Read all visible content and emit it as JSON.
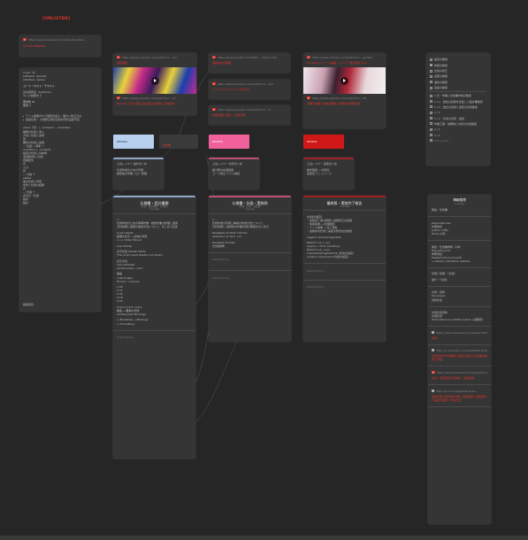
{
  "board": {
    "title": "[UNLISTED]",
    "accent": "#e4362c",
    "background": "#262626"
  },
  "left_link": {
    "url": "https://www.docswell.com/s/6/a-derivative",
    "title": "ACTIVE PENDING"
  },
  "notes": {
    "header_lines": [
      "Code：Ⓜ",
      "software: derived",
      "interface: derive"
    ],
    "subtitle": "コード・カスト・テキスト",
    "meta_lines": [
      "近似値算出（systems)",
      "ちくわ鍵屋まで"
    ],
    "count_lines": [
      "要素数 81",
      "要素 0"
    ],
    "bullets": [
      "テスト結果がUIで閲覧出来る・細かい修正済み",
      "追加仕様・ 大幅修正後の自然計算式実装予定"
    ],
    "tree": [
      "value（式） ← (ordered — evaluate)",
      "  種類の仕様と導入",
      "  方法と仕様と実例",
      "  例",
      "  要件の仕様と実例",
      "— 仕組 ← 解析 ↑",
      "modifiers ← contexts",
      "  設定の仕様と具体例",
      "  (処理状態と仕様)",
      "  自動配列",
      "  式",
      "  入力",
      "  式",
      "— 分岐 ↑",
      "states",
      "  値の仕様と作用",
      "  条件と仕様の結果",
      "  式",
      "— 仕組 ↑",
      "表示の・仕様",
      "  操作",
      "  設計"
    ],
    "footer": "関連項目"
  },
  "videos": [
    {
      "url": "https://www.youtube.com/watch?v=...abc",
      "title": "回転図面"
    },
    {
      "url": "https://youtu.be/Mcch7m8L90 — tutorial link",
      "title": "回転物の切断面"
    },
    {
      "url": "https://www.youtube.com/watch?v=...gsn9zh",
      "title": "YouTubeストリーム講座 - メンバー限定配信 Vol.1"
    }
  ],
  "video_links_b": [
    {
      "url": "https://www.youtube.com/watch?v=...b7",
      "title": "Blender入門4 回転と拡大縮小の操作と基本操作"
    },
    {
      "url": "https://www.youtube.com/watch?v=...k12",
      "title": "ビジュアルスクリプトで作るUI"
    },
    {
      "url": "https://www.youtube.com/watch?v=...m3",
      "title": "中間処理と応用 — 実装演習"
    }
  ],
  "video_links_c": [
    {
      "url": "https://www.youtube.com/watch?v=...r2",
      "title": "記事"
    },
    {
      "url": "https://www.youtube.com/watch?v=...h8",
      "title": "手書き作業と内容の要約と効果的な整理方法"
    }
  ],
  "chips": [
    {
      "label": "DESIGN",
      "bg": "#b8d0f0",
      "fg": "#2a2a2a"
    },
    {
      "label": "",
      "bg": "#3a3a3a",
      "fg": "#e4362c",
      "sub": "仕様書"
    },
    {
      "label": "REVIEW",
      "bg": "#f0609a",
      "fg": "#ffffff"
    },
    {
      "label": "STATUS",
      "bg": "#d01818",
      "fg": "#ffffff"
    }
  ],
  "mini_cards": [
    {
      "lines": [
        "上位レイヤー 設計まとめ",
        "",
        "仕様作成のための手順",
        "確認後の作業 フロー整理"
      ],
      "bar": "#8fa8c8"
    },
    {
      "lines": [
        "上位レイヤー 共有まとめ",
        "",
        "各分野の共通認識",
        "コード修正 テスト検証"
      ],
      "bar": "#c05070"
    },
    {
      "lines": [
        "上位レイヤー 実装まとめ",
        "",
        "動作確認 → 仕様化",
        "実装完了と リリース"
      ],
      "bar": "#a02020"
    }
  ],
  "columns": [
    {
      "title": "仕様書・設計書類",
      "subtitle": "（仕様・設計書類・計画案）",
      "meta": "In scope",
      "bar": "#8fa8c8",
      "body": [
        "□",
        "仕様作成のための準備作業・確認作業の整理と運用",
        "方針説明と結果の確認方法について、まとめて記述",
        "",
        "Code Viewer",
        "  結果を表示 → 反映の状態",
        "  <<< Order Moved",
        "",
        "Live Shader",
        "",
        "表示仕様 Shader Editor",
        "This unit's input shader not shown",
        "",
        "表示方法",
        "sourceShader",
        "surface.pack → surf",
        "",
        "描画",
        "output.rgba",
        "fil.color → out.pix",
        "",
        "1.00",
        "0.72",
        "0.35",
        "0.18",
        "0.25",
        "",
        "0.5.0 / 0.2.0 / 0.0.1",
        "構造 → 要素の状態",
        "surface.pack Bindings",
        "",
        "← Bindables → Bindings",
        "← Formatting"
      ],
      "placeholder": "Start typing..."
    },
    {
      "title": "仕様書・計画・実装例",
      "subtitle": "（仕様・計画・実装例）",
      "meta": "In scope",
      "bar": "#c05070",
      "body": [
        "□",
        "仕様作成の手順と構成の作成方法について、",
        "方針説明と 段階的な作業手順の確認をまとめる",
        "",
        "Reusable Location Domain",
        "  extension  (1 hour +1)",
        "",
        "Reusable Domain",
        "  (仕様説明)"
      ],
      "placeholder": "Start typing..."
    },
    {
      "title": "最終版・実装完了報告",
      "subtitle": "In scope",
      "meta": "",
      "bar": "#a02020",
      "body": [
        "[仕様の確定]",
        "・実装完了後の確認と最終修正の実施",
        "・本番適用 → 反映確認",
        "・テスト結果 → 完了報告",
        "・最終的な仕様と実装の整合性を確認",
        "",
        "Legend: Dump/magicable",
        "",
        "Result in.js  ↓ e.js",
        "  require → from (result.js)",
        "Result in.js → e.js",
        "  interactiveFragmentLib  (仕様の設定)",
        "  surface.component  (仕様の設定)"
      ],
      "placeholder": "Start typing..."
    }
  ],
  "checklist": {
    "items": [
      {
        "label": "設定の確認",
        "on": false
      },
      {
        "label": "参照の確認",
        "on": true
      },
      {
        "label": "仕様の修正",
        "on": false
      },
      {
        "label": "実装の確認",
        "on": false
      },
      {
        "label": "進捗の確認",
        "on": false
      },
      {
        "label": "追加の確認",
        "on": false
      }
    ],
    "tasks": [
      {
        "label": "1 日・作業と仕様書作成の確認",
        "on": false
      },
      {
        "label": "1 / 1：過去の記録を収集して設計書確認",
        "on": false
      },
      {
        "label": "1 / 1：過去の記録と実装の仕様確認",
        "on": false
      },
      {
        "label": "1 / 1",
        "on": false
      },
      {
        "label": "1 / 1：仕様の比較・追加",
        "on": false
      },
      {
        "label": "作業工程・成果物と共有の仕様確認",
        "on": false
      },
      {
        "label": "1 / 1",
        "on": false
      },
      {
        "label": "1 / 1",
        "on": false
      },
      {
        "label": "Add a task...",
        "on": false
      }
    ]
  },
  "right_panel": {
    "title": "情報整理",
    "subtitle": "In scope",
    "sections": [
      [
        "関連・仕様書"
      ],
      [
        "Dependencies",
        "  外部依存",
        "    python  (1件)",
        "    three  (1件)"
      ],
      [
        "関連・仕様書参照（1件）",
        "Repository.md",
        "  参照項目",
        "    Related (Find yourself)",
        "    → reload ( relocation relative"
      ],
      [
        "状態と整理・（仕様）",
        "",
        "進行・（仕様）"
      ],
      [
        "仕様・資料",
        "Developer",
        "資料仕様"
      ],
      [
        "仕様仕様資料",
        "共通仕様",
        "Hello Owner 0.1.0000 custom 公開時刻"
      ]
    ],
    "links": [
      {
        "url": "https://www.docswell.com/s/a/abcdef/5",
        "title": "仕様",
        "icon": "pen"
      },
      {
        "url": "https://x.example.com/i/web/status/18...",
        "title": "仕様資料を作成機能と実装の連携と仕様書の確認と管理",
        "icon": "doc"
      },
      {
        "url": "https://www.docswell.com/s/a/b/stories/4",
        "title": "仕様・実装資料の最新版・実装記録",
        "icon": "yt"
      },
      {
        "url": "https://x.com/i/web/status/18...",
        "title": "関連記事 仕様説明 内容と追加説明と説明資料で実装の確認と作成方法",
        "icon": "pen"
      }
    ]
  }
}
